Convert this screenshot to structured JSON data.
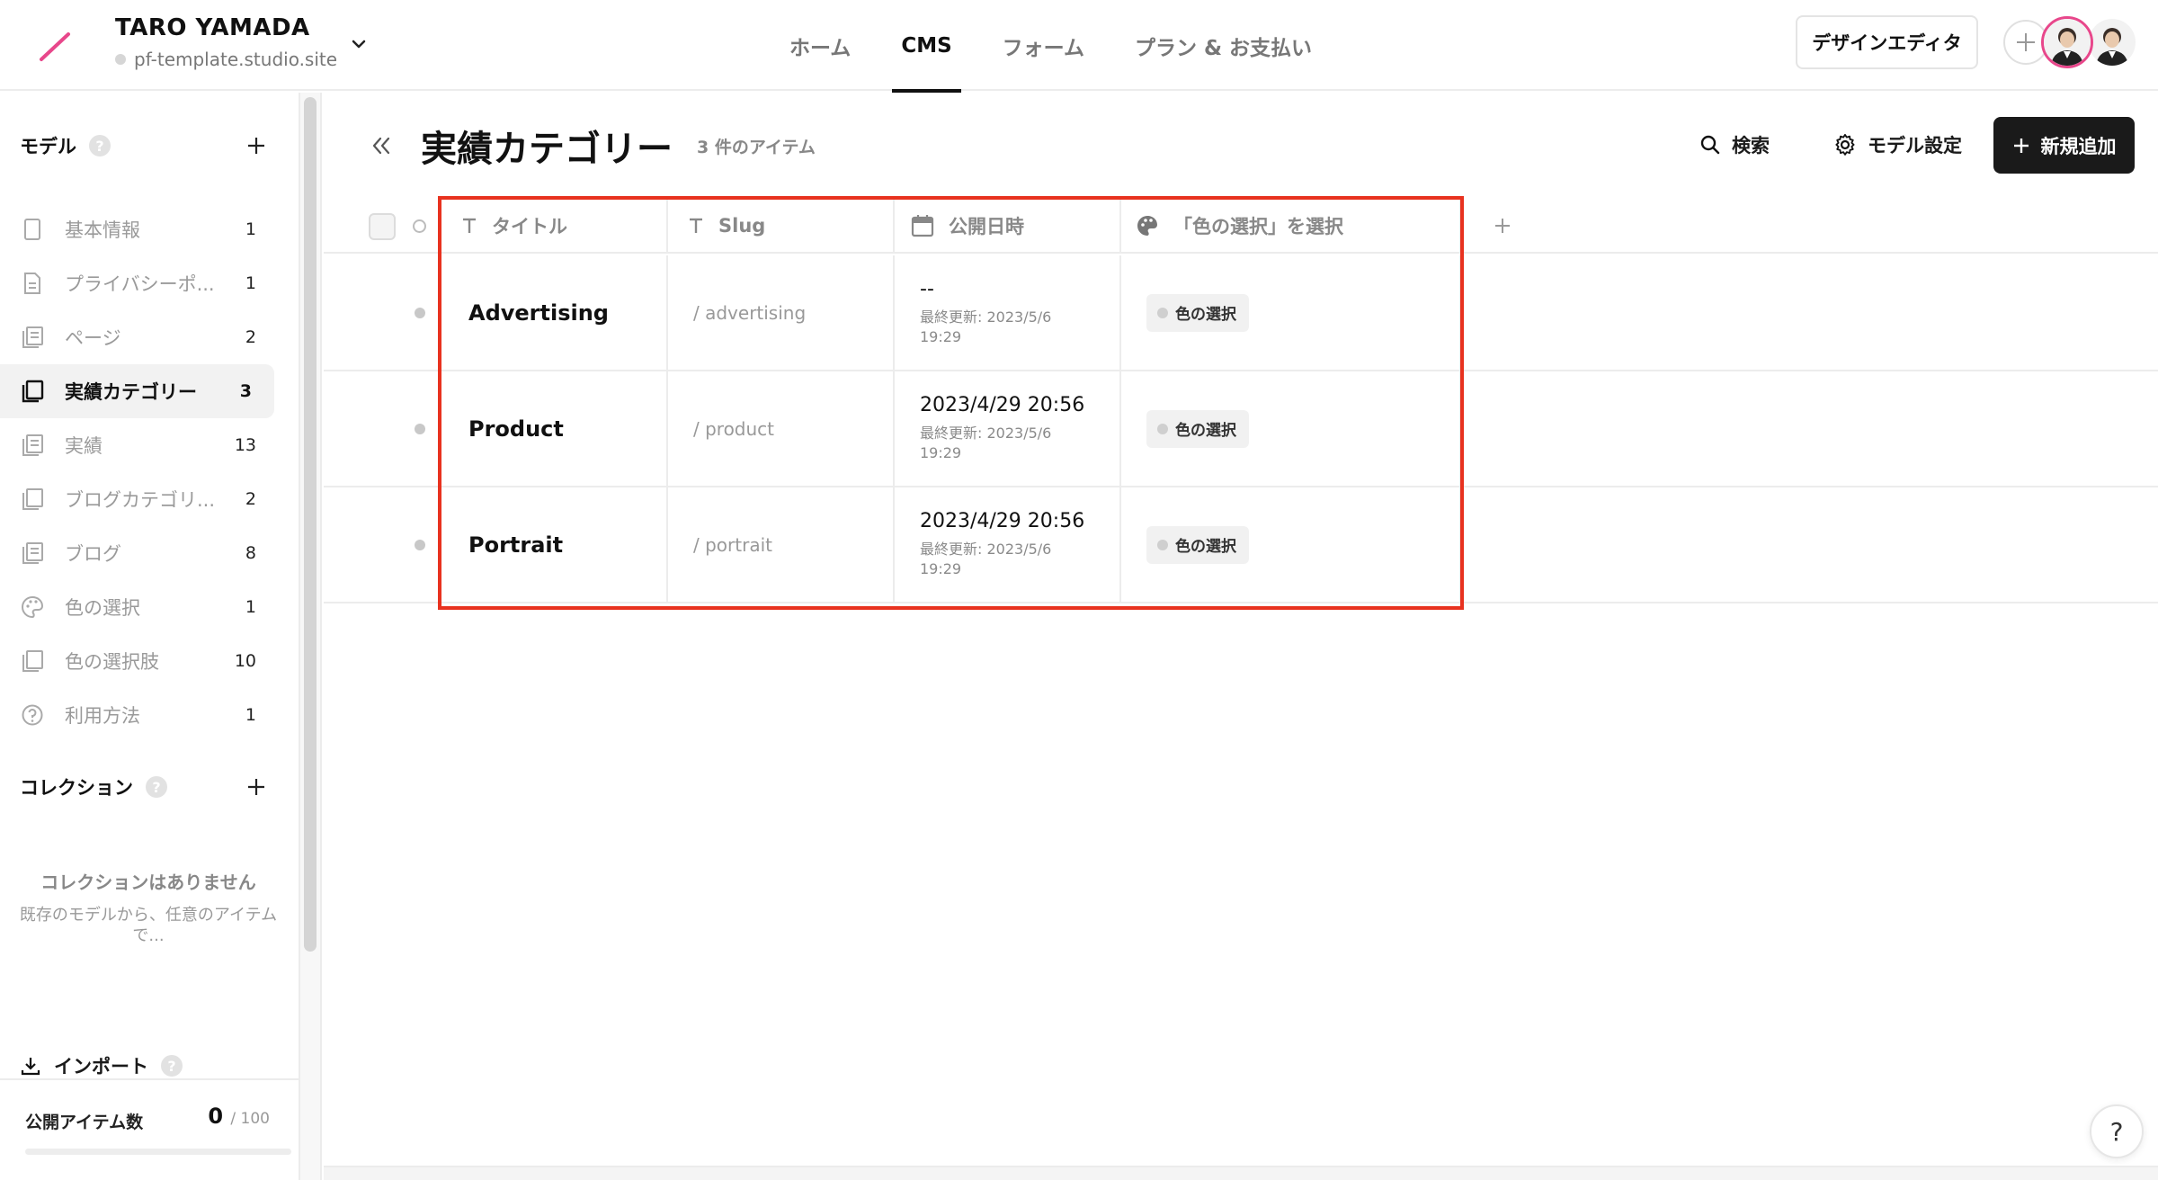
{
  "project": {
    "name": "TARO YAMADA",
    "site": "pf-template.studio.site"
  },
  "nav": {
    "items": [
      {
        "label": "ホーム",
        "active": false
      },
      {
        "label": "CMS",
        "active": true
      },
      {
        "label": "フォーム",
        "active": false
      },
      {
        "label": "プラン & お支払い",
        "active": false
      }
    ]
  },
  "header": {
    "design_editor_label": "デザインエディタ"
  },
  "sidebar": {
    "models_heading": "モデル",
    "models": [
      {
        "label": "基本情報",
        "count": "1",
        "icon": "single-page-icon",
        "active": false
      },
      {
        "label": "プライバシーポ...",
        "count": "1",
        "icon": "document-icon",
        "active": false
      },
      {
        "label": "ページ",
        "count": "2",
        "icon": "collection-icon",
        "active": false
      },
      {
        "label": "実績カテゴリー",
        "count": "3",
        "icon": "collection-icon",
        "active": true
      },
      {
        "label": "実績",
        "count": "13",
        "icon": "collection-icon",
        "active": false
      },
      {
        "label": "ブログカテゴリ...",
        "count": "2",
        "icon": "collection-icon",
        "active": false
      },
      {
        "label": "ブログ",
        "count": "8",
        "icon": "collection-icon",
        "active": false
      },
      {
        "label": "色の選択",
        "count": "1",
        "icon": "palette-icon",
        "active": false
      },
      {
        "label": "色の選択肢",
        "count": "10",
        "icon": "collection-icon",
        "active": false
      },
      {
        "label": "利用方法",
        "count": "1",
        "icon": "question-circle-icon",
        "active": false
      }
    ],
    "collections_heading": "コレクション",
    "collections_empty_title": "コレクションはありません",
    "collections_empty_desc": "既存のモデルから、任意のアイテムで...",
    "import_label": "インポート",
    "published_label": "公開アイテム数",
    "published_count": "0",
    "published_limit": "/ 100",
    "published_fraction": 0
  },
  "main": {
    "title": "実績カテゴリー",
    "item_count": "3 件のアイテム",
    "search_label": "検索",
    "model_settings_label": "モデル設定",
    "new_label": "新規追加",
    "columns": [
      {
        "label": "タイトル",
        "icon": "text-type-icon"
      },
      {
        "label": "Slug",
        "icon": "text-type-icon"
      },
      {
        "label": "公開日時",
        "icon": "calendar-icon"
      },
      {
        "label": "「色の選択」を選択",
        "icon": "palette-icon"
      }
    ],
    "rows": [
      {
        "title": "Advertising",
        "slug": "/ advertising",
        "published": "--",
        "updated": "最終更新: 2023/5/6 19:29",
        "color": "色の選択"
      },
      {
        "title": "Product",
        "slug": "/ product",
        "published": "2023/4/29 20:56",
        "updated": "最終更新: 2023/5/6 19:29",
        "color": "色の選択"
      },
      {
        "title": "Portrait",
        "slug": "/ portrait",
        "published": "2023/4/29 20:56",
        "updated": "最終更新: 2023/5/6 19:29",
        "color": "色の選択"
      }
    ]
  },
  "help_label": "?",
  "colors": {
    "accent": "#e8478b",
    "highlight_box": "#e8321f",
    "primary_button": "#1a1a1a"
  }
}
